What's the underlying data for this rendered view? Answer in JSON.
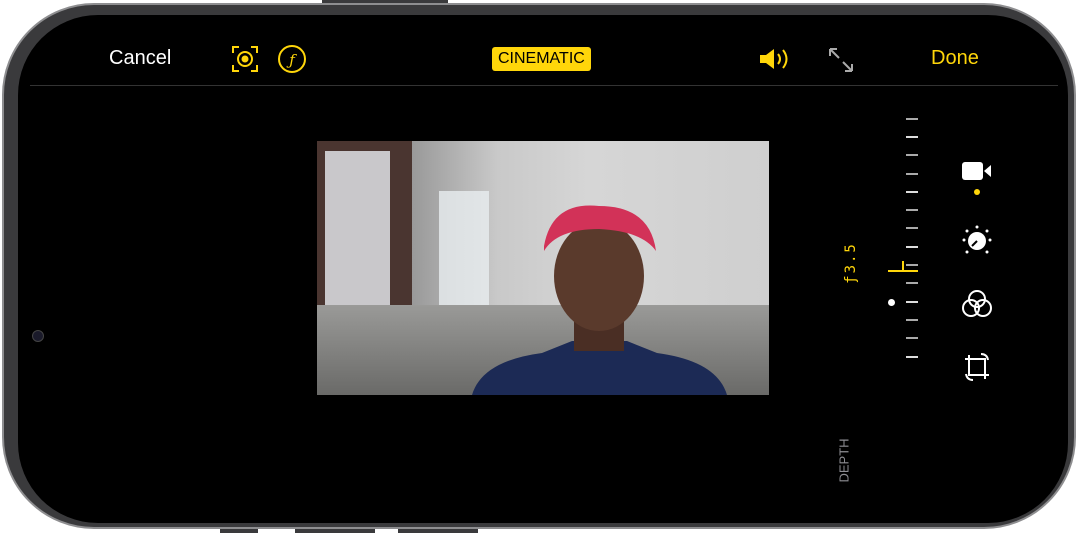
{
  "toolbar": {
    "cancel": "Cancel",
    "mode_badge": "CINEMATIC",
    "done": "Done"
  },
  "depth": {
    "aperture": "ƒ3.5",
    "label": "DEPTH",
    "level": 0.62
  },
  "side_tools": [
    {
      "name": "video",
      "active": true
    },
    {
      "name": "adjust"
    },
    {
      "name": "filters"
    },
    {
      "name": "crop"
    }
  ],
  "colors": {
    "accent": "#ffd60a",
    "background": "#000000"
  }
}
